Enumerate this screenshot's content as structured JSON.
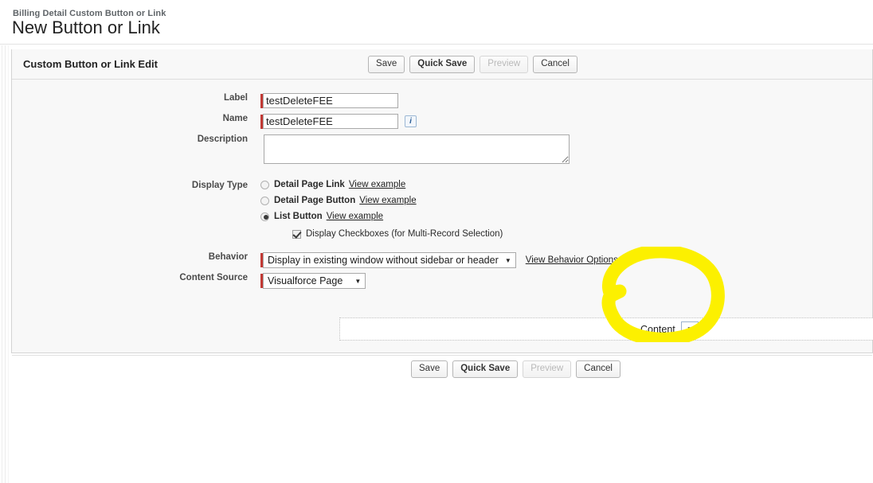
{
  "header": {
    "breadcrumb": "Billing Detail Custom Button or Link",
    "title": "New Button or Link"
  },
  "panel": {
    "title": "Custom Button or Link Edit",
    "buttons": [
      {
        "label": "Save",
        "state": "enabled",
        "emphasis": "normal"
      },
      {
        "label": "Quick Save",
        "state": "enabled",
        "emphasis": "bold"
      },
      {
        "label": "Preview",
        "state": "disabled",
        "emphasis": "normal"
      },
      {
        "label": "Cancel",
        "state": "enabled",
        "emphasis": "normal"
      }
    ]
  },
  "form": {
    "label_field": {
      "label": "Label",
      "value": "testDeleteFEE",
      "required": true
    },
    "name_field": {
      "label": "Name",
      "value": "testDeleteFEE",
      "required": true,
      "info_icon": "info-icon",
      "info_glyph": "i"
    },
    "description_field": {
      "label": "Description",
      "value": "",
      "required": false
    },
    "display_type": {
      "label": "Display Type",
      "options": [
        {
          "label": "Detail Page Link",
          "link": "View example",
          "selected": false
        },
        {
          "label": "Detail Page Button",
          "link": "View example",
          "selected": false
        },
        {
          "label": "List Button",
          "link": "View example",
          "selected": true
        }
      ],
      "checkbox": {
        "label": "Display Checkboxes (for Multi-Record Selection)",
        "checked": true
      }
    },
    "behavior": {
      "label": "Behavior",
      "value": "Display in existing window without sidebar or header",
      "required": true,
      "link": "View Behavior Options"
    },
    "content_source": {
      "label": "Content Source",
      "value": "Visualforce Page",
      "required": true
    },
    "content": {
      "label": "Content",
      "dropdown_glyph": "▼"
    }
  },
  "annotation": {
    "type": "hand-drawn-ellipse",
    "color": "#FCF000",
    "target": "content-select"
  },
  "colors": {
    "panel_top_bar": "#5b6a80",
    "required_marker": "#c23934",
    "panel_background": "#f8f8f8",
    "marker_yellow": "#FCF000"
  }
}
